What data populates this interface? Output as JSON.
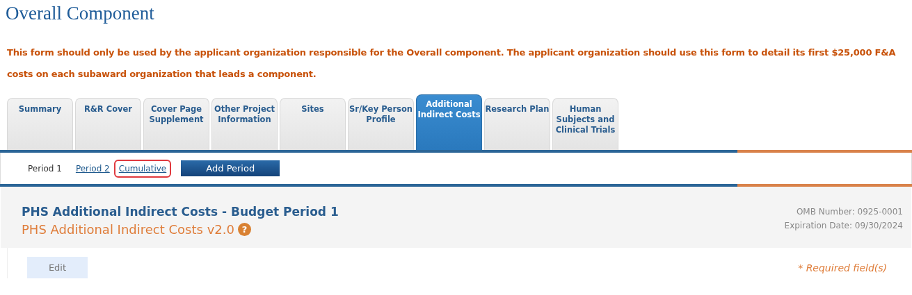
{
  "page_title": "Overall Component",
  "notice": "This form should only be used by the applicant organization responsible for the Overall component.  The applicant organization should use this form to detail its first $25,000 F&A costs on each subaward organization that leads a component.",
  "tabs": [
    {
      "label": "Summary",
      "selected": false
    },
    {
      "label": "R&R Cover",
      "selected": false
    },
    {
      "label": "Cover Page Supplement",
      "selected": false
    },
    {
      "label": "Other Project Information",
      "selected": false
    },
    {
      "label": "Sites",
      "selected": false
    },
    {
      "label": "Sr/Key Person Profile",
      "selected": false
    },
    {
      "label": "Additional Indirect Costs",
      "selected": true
    },
    {
      "label": "Research Plan",
      "selected": false
    },
    {
      "label": "Human Subjects and Clinical Trials",
      "selected": false
    }
  ],
  "periods": [
    {
      "label": "Period 1",
      "selected": true,
      "highlighted": false
    },
    {
      "label": "Period 2",
      "selected": false,
      "highlighted": false
    },
    {
      "label": "Cumulative",
      "selected": false,
      "highlighted": true
    }
  ],
  "add_period_button": "Add Period",
  "form": {
    "title": "PHS Additional Indirect Costs - Budget Period 1",
    "subtitle": "PHS Additional Indirect Costs v2.0",
    "help_icon": "?",
    "omb_number": "OMB Number: 0925-0001",
    "expiration": "Expiration Date: 09/30/2024",
    "edit_button": "Edit",
    "required_note": "* Required field(s)"
  }
}
